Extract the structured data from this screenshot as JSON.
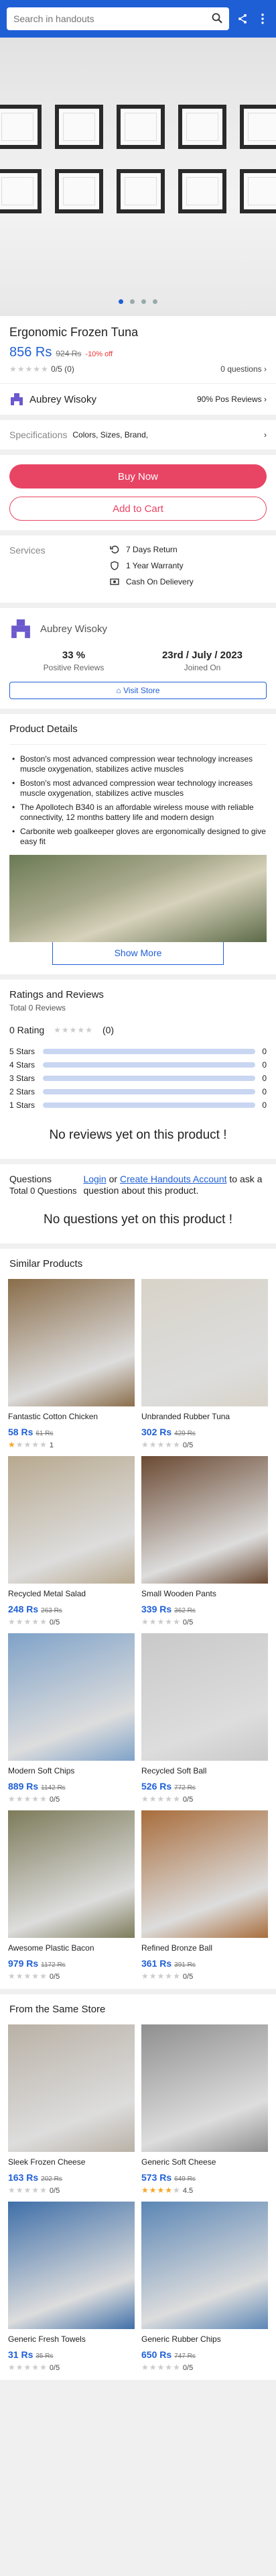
{
  "search": {
    "placeholder": "Search in handouts"
  },
  "hero": {
    "active_dot": 0,
    "dot_count": 4
  },
  "product": {
    "title": "Ergonomic Frozen Tuna",
    "price": "856 Rs",
    "old_price": "924 Rs",
    "discount": "-10% off",
    "rating_text": "0/5 (0)",
    "rating_value": 0,
    "questions": "0 questions"
  },
  "seller_row": {
    "name": "Aubrey Wisoky",
    "positive": "90% Pos Reviews"
  },
  "specifications": {
    "label": "Specifications",
    "value": "Colors, Sizes, Brand,"
  },
  "actions": {
    "buy": "Buy Now",
    "cart": "Add to Cart"
  },
  "services": {
    "label": "Services",
    "items": [
      {
        "icon": "return-icon",
        "text": "7 Days Return"
      },
      {
        "icon": "warranty-icon",
        "text": "1 Year Warranty"
      },
      {
        "icon": "cash-icon",
        "text": "Cash On Delievery"
      }
    ]
  },
  "seller_card": {
    "name": "Aubrey Wisoky",
    "positive_value": "33 %",
    "positive_label": "Positive Reviews",
    "joined_value": "23rd / July / 2023",
    "joined_label": "Joined On",
    "visit": "Visit Store"
  },
  "details": {
    "title": "Product Details",
    "bullets": [
      "Boston's most advanced compression wear technology increases muscle oxygenation, stabilizes active muscles",
      "Boston's most advanced compression wear technology increases muscle oxygenation, stabilizes active muscles",
      "The Apollotech B340 is an affordable wireless mouse with reliable connectivity, 12 months battery life and modern design",
      "Carbonite web goalkeeper gloves are ergonomically designed to give easy fit"
    ],
    "more": "Show More"
  },
  "ratings": {
    "title": "Ratings and Reviews",
    "total": "Total 0 Reviews",
    "rating_label": "0 Rating",
    "rating_count": "(0)",
    "rows": [
      {
        "label": "5 Stars",
        "count": "0",
        "fraction": 0
      },
      {
        "label": "4 Stars",
        "count": "0",
        "fraction": 0
      },
      {
        "label": "3 Stars",
        "count": "0",
        "fraction": 0
      },
      {
        "label": "2 Stars",
        "count": "0",
        "fraction": 0
      },
      {
        "label": "1 Stars",
        "count": "0",
        "fraction": 0
      }
    ],
    "empty": "No reviews yet on this product !"
  },
  "questions": {
    "title": "Questions",
    "total": "Total 0 Questions",
    "login": "Login",
    "or": "or",
    "create": "Create Handouts Account",
    "tail": "to ask a question about this product.",
    "empty": "No questions yet on this product !"
  },
  "similar": {
    "title": "Similar Products",
    "items": [
      {
        "name": "Fantastic Cotton Chicken",
        "price": "58 Rs",
        "old": "61 Rs",
        "rating": "1",
        "stars": 1,
        "color": "#8a6d4a"
      },
      {
        "name": "Unbranded Rubber Tuna",
        "price": "302 Rs",
        "old": "429 Rs",
        "rating": "0/5",
        "stars": 0,
        "color": "#d8d3c8"
      },
      {
        "name": "Recycled Metal Salad",
        "price": "248 Rs",
        "old": "263 Rs",
        "rating": "0/5",
        "stars": 0,
        "color": "#b8a98f"
      },
      {
        "name": "Small Wooden Pants",
        "price": "339 Rs",
        "old": "362 Rs",
        "rating": "0/5",
        "stars": 0,
        "color": "#6b4a33"
      },
      {
        "name": "Modern Soft Chips",
        "price": "889 Rs",
        "old": "1142 Rs",
        "rating": "0/5",
        "stars": 0,
        "color": "#7fa2c8"
      },
      {
        "name": "Recycled Soft Ball",
        "price": "526 Rs",
        "old": "772 Rs",
        "rating": "0/5",
        "stars": 0,
        "color": "#c9c9c9"
      },
      {
        "name": "Awesome Plastic Bacon",
        "price": "979 Rs",
        "old": "1172 Rs",
        "rating": "0/5",
        "stars": 0,
        "color": "#7d7b5a"
      },
      {
        "name": "Refined Bronze Ball",
        "price": "361 Rs",
        "old": "391 Rs",
        "rating": "0/5",
        "stars": 0,
        "color": "#a86d3c"
      }
    ]
  },
  "same_store": {
    "title": "From the Same Store",
    "items": [
      {
        "name": "Sleek Frozen Cheese",
        "price": "163 Rs",
        "old": "202 Rs",
        "rating": "0/5",
        "stars": 0,
        "color": "#b9b1a6"
      },
      {
        "name": "Generic Soft Cheese",
        "price": "573 Rs",
        "old": "649 Rs",
        "rating": "4.5",
        "stars": 4.5,
        "color": "#8f8f8f"
      },
      {
        "name": "Generic Fresh Towels",
        "price": "31 Rs",
        "old": "35 Rs",
        "rating": "0/5",
        "stars": 0,
        "color": "#3f6fa8"
      },
      {
        "name": "Generic Rubber Chips",
        "price": "650 Rs",
        "old": "747 Rs",
        "rating": "0/5",
        "stars": 0,
        "color": "#5b86b5"
      }
    ]
  },
  "colors": {
    "accent": "#1f5fd6",
    "buy": "#e84464",
    "star": "#f5a623"
  }
}
